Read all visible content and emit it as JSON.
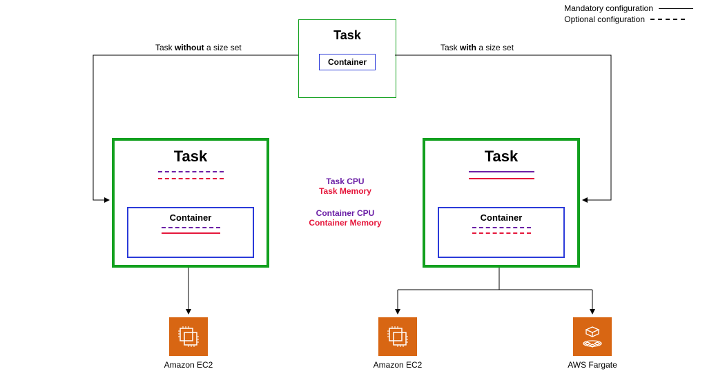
{
  "legend": {
    "mandatory": "Mandatory configuration",
    "optional": "Optional configuration"
  },
  "top_task": {
    "title": "Task",
    "container": "Container"
  },
  "edge_labels": {
    "without": "Task without a size set",
    "without_bold": "without",
    "with": "Task with a size set",
    "with_bold": "with"
  },
  "left_task": {
    "title": "Task",
    "container_title": "Container",
    "task_cpu_style": "dashed",
    "task_mem_style": "dashed",
    "container_cpu_style": "dashed",
    "container_mem_style": "solid"
  },
  "right_task": {
    "title": "Task",
    "container_title": "Container",
    "task_cpu_style": "solid",
    "task_mem_style": "solid",
    "container_cpu_style": "dashed",
    "container_mem_style": "dashed"
  },
  "mid_labels": {
    "task_cpu": "Task CPU",
    "task_memory": "Task Memory",
    "container_cpu": "Container CPU",
    "container_memory": "Container Memory"
  },
  "targets": {
    "ec2_left": "Amazon EC2",
    "ec2_right": "Amazon EC2",
    "fargate": "AWS Fargate"
  },
  "colors": {
    "green": "#12a01e",
    "blue": "#2b3ad9",
    "purple": "#6b1fa6",
    "red": "#e5163b",
    "orange": "#d86613"
  }
}
